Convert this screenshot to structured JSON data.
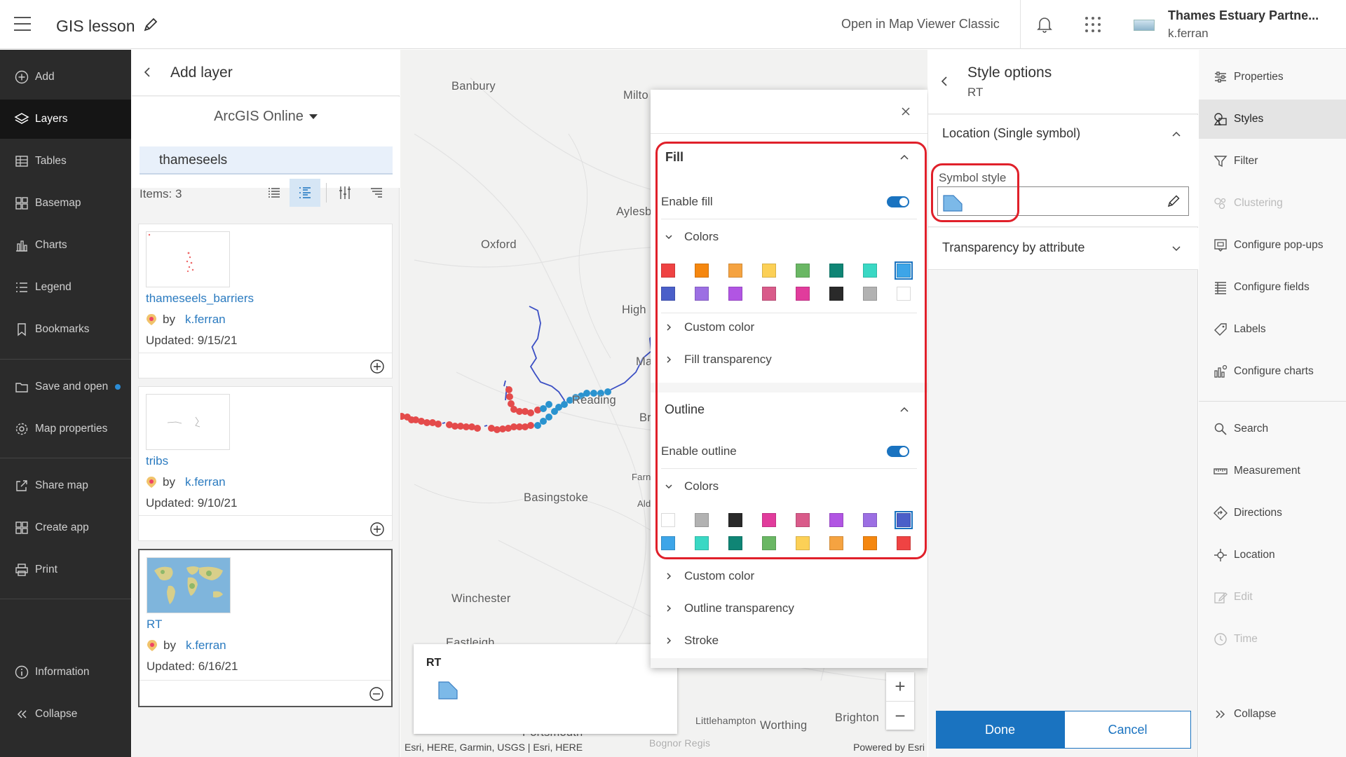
{
  "header": {
    "title": "GIS lesson",
    "open_classic": "Open in Map Viewer Classic",
    "org_name": "Thames Estuary Partne...",
    "username": "k.ferran"
  },
  "left_toolbar": {
    "items": [
      {
        "label": "Add",
        "icon": "plus-circle-icon"
      },
      {
        "label": "Layers",
        "icon": "layers-icon"
      },
      {
        "label": "Tables",
        "icon": "table-icon"
      },
      {
        "label": "Basemap",
        "icon": "basemap-icon"
      },
      {
        "label": "Charts",
        "icon": "bar-chart-icon"
      },
      {
        "label": "Legend",
        "icon": "legend-icon"
      },
      {
        "label": "Bookmarks",
        "icon": "bookmark-icon"
      },
      {
        "label": "Save and open",
        "icon": "folder-icon"
      },
      {
        "label": "Map properties",
        "icon": "gear-icon"
      },
      {
        "label": "Share map",
        "icon": "share-icon"
      },
      {
        "label": "Create app",
        "icon": "grid-icon"
      },
      {
        "label": "Print",
        "icon": "printer-icon"
      },
      {
        "label": "Information",
        "icon": "info-icon"
      },
      {
        "label": "Collapse",
        "icon": "collapse-icon"
      }
    ]
  },
  "add_layer": {
    "title": "Add layer",
    "source": "ArcGIS Online",
    "search_value": "thameseels",
    "items_count": "Items: 3",
    "results": [
      {
        "name": "thameseels_barriers",
        "by": "by",
        "owner": "k.ferran",
        "updated": "Updated: 9/15/21"
      },
      {
        "name": "tribs",
        "by": "by",
        "owner": "k.ferran",
        "updated": "Updated: 9/10/21"
      },
      {
        "name": "RT",
        "by": "by",
        "owner": "k.ferran",
        "updated": "Updated: 6/16/21"
      }
    ]
  },
  "map": {
    "places": [
      "Banbury",
      "Milto",
      "Oxford",
      "Aylesb",
      "High",
      "Ma",
      "Reading",
      "Br",
      "Farn",
      "Ald",
      "Basingstoke",
      "Winchester",
      "Eastleigh",
      "Portsmouth",
      "Bognor Regis",
      "Littlehampton",
      "Worthing",
      "Brighton",
      "Banbury"
    ],
    "attribution": "Esri, HERE, Garmin, USGS | Esri, HERE",
    "powered_by": "Powered by Esri",
    "legend_title": "RT"
  },
  "style_popup": {
    "fill": {
      "title": "Fill",
      "enable_label": "Enable fill",
      "colors_label": "Colors",
      "custom_color": "Custom color",
      "transparency": "Fill transparency",
      "swatches": [
        "#ef4343",
        "#f5870f",
        "#f5a341",
        "#fcd056",
        "#6ab764",
        "#0f8575",
        "#3ad8c4",
        "#3da5e8",
        "#4a5fc9",
        "#9c6fe3",
        "#b155e3",
        "#d95b8a",
        "#e13c9c",
        "#2a2a2a",
        "#b2b2b2",
        "#ffffff"
      ]
    },
    "outline": {
      "title": "Outline",
      "enable_label": "Enable outline",
      "colors_label": "Colors",
      "custom_color": "Custom color",
      "transparency": "Outline transparency",
      "stroke": "Stroke",
      "swatches": [
        "#ffffff",
        "#b2b2b2",
        "#2a2a2a",
        "#e13c9c",
        "#d95b8a",
        "#b155e3",
        "#9c6fe3",
        "#4a5fc9",
        "#3da5e8",
        "#3ad8c4",
        "#0f8575",
        "#6ab764",
        "#fcd056",
        "#f5a341",
        "#f5870f",
        "#ef4343"
      ]
    }
  },
  "style_options": {
    "title": "Style options",
    "layer": "RT",
    "location_label": "Location (Single symbol)",
    "symbol_style_label": "Symbol style",
    "transparency_label": "Transparency by attribute",
    "done": "Done",
    "cancel": "Cancel"
  },
  "right_toolbar": {
    "items": [
      {
        "label": "Properties",
        "icon": "sliders-icon"
      },
      {
        "label": "Styles",
        "icon": "styles-icon"
      },
      {
        "label": "Filter",
        "icon": "filter-icon"
      },
      {
        "label": "Clustering",
        "icon": "clustering-icon"
      },
      {
        "label": "Configure pop-ups",
        "icon": "popup-icon"
      },
      {
        "label": "Configure fields",
        "icon": "fields-icon"
      },
      {
        "label": "Labels",
        "icon": "label-icon"
      },
      {
        "label": "Configure charts",
        "icon": "chart-config-icon"
      },
      {
        "label": "Search",
        "icon": "search-icon"
      },
      {
        "label": "Measurement",
        "icon": "ruler-icon"
      },
      {
        "label": "Directions",
        "icon": "directions-icon"
      },
      {
        "label": "Location",
        "icon": "location-icon"
      },
      {
        "label": "Edit",
        "icon": "edit-icon"
      },
      {
        "label": "Time",
        "icon": "clock-icon"
      },
      {
        "label": "Collapse",
        "icon": "expand-icon"
      }
    ]
  },
  "colors": {
    "accent": "#1a73c0",
    "highlight": "#e0202a",
    "river_red": "#e44b4b",
    "river_blue": "#2a93cf",
    "river_line": "#3b4fc4"
  }
}
